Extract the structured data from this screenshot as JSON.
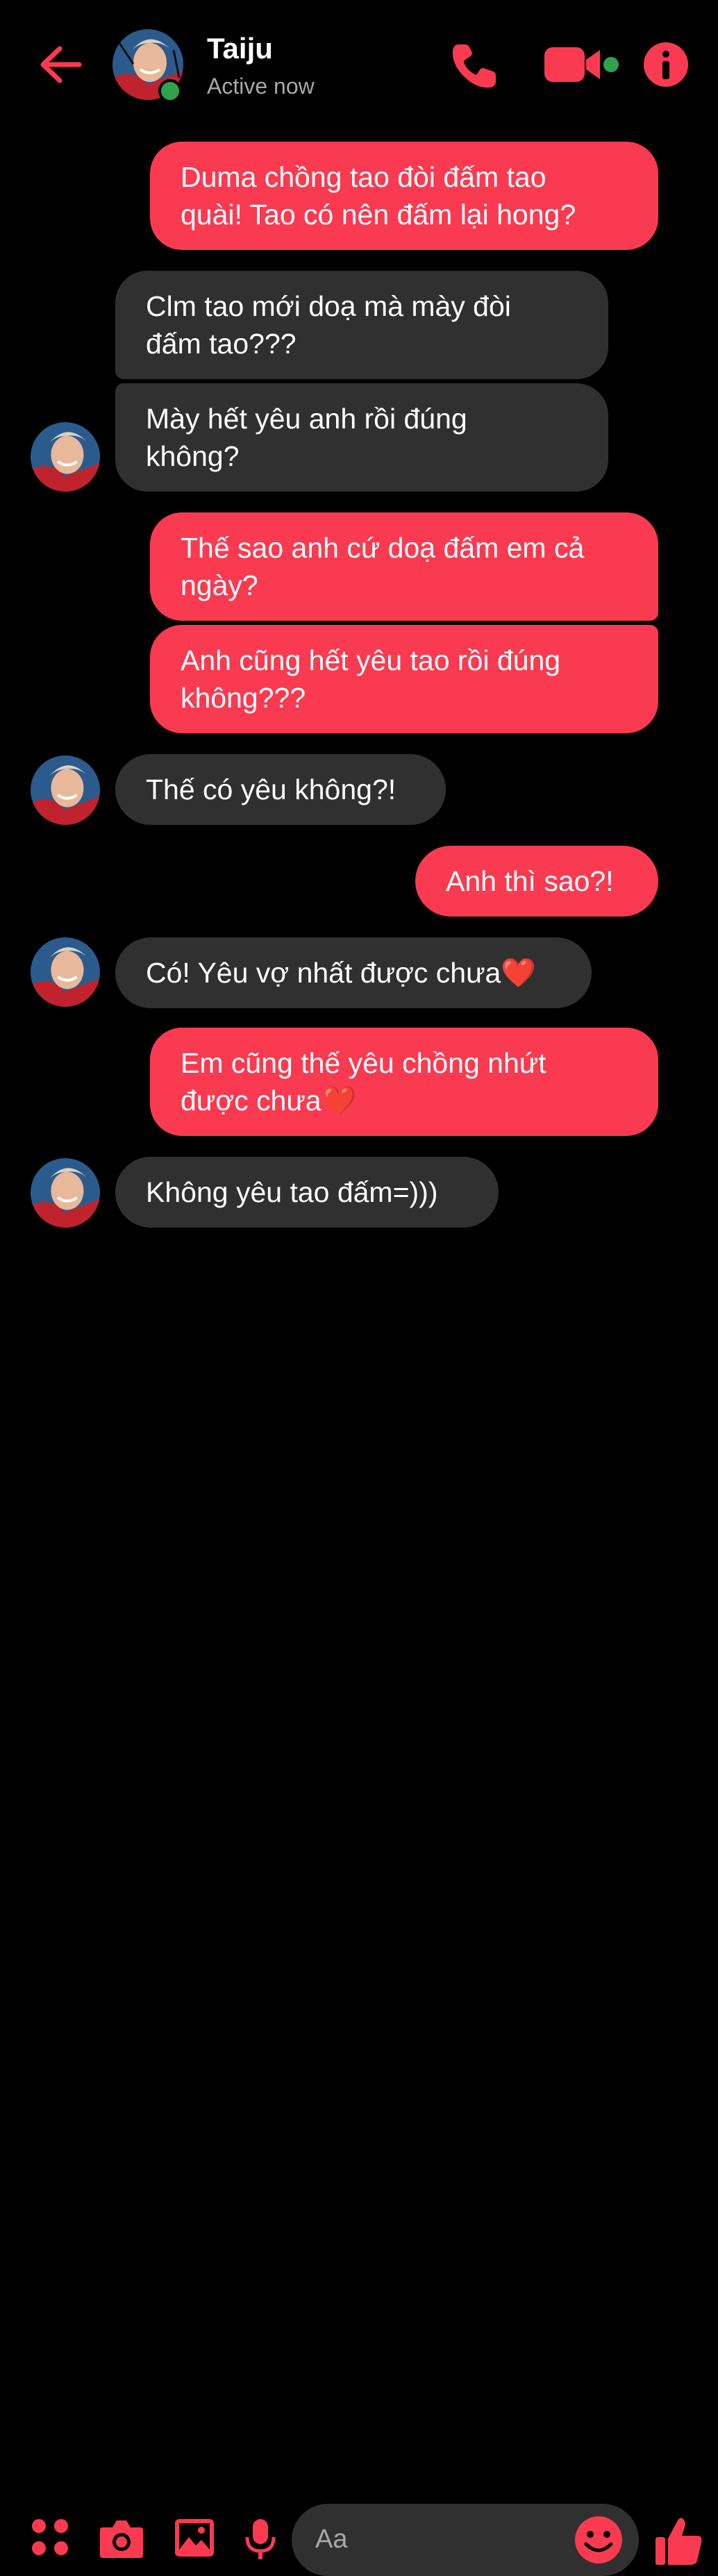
{
  "header": {
    "contact_name": "Taiju",
    "status": "Active now"
  },
  "messages": [
    {
      "side": "out",
      "text": "Duma chồng tao đòi đấm tao\nquài! Tao có nên đấm lại hong?"
    },
    {
      "side": "in",
      "text": "Clm tao mới doạ mà mày đòi\nđấm tao???"
    },
    {
      "side": "in",
      "text": "Mày hết yêu anh rồi đúng\nkhông?"
    },
    {
      "side": "out",
      "text": "Thế sao anh cứ doạ đấm em cả\nngày?"
    },
    {
      "side": "out",
      "text": "Anh cũng hết yêu tao rồi đúng\nkhông???"
    },
    {
      "side": "in",
      "text": "Thế có yêu không?!"
    },
    {
      "side": "out",
      "text": "Anh thì sao?!"
    },
    {
      "side": "in",
      "text": "Có! Yêu vợ nhất được chưa❤️"
    },
    {
      "side": "out",
      "text": "Em cũng thế yêu chồng nhứt\nđược chưa❤️"
    },
    {
      "side": "in",
      "text": "Không yêu tao đấm=)))"
    }
  ],
  "composer": {
    "placeholder": "Aa"
  },
  "colors": {
    "accent": "#fa3a50",
    "incoming_bubble": "#303030",
    "online": "#31a24c",
    "background": "#000000"
  },
  "icons": [
    "back-arrow-icon",
    "phone-icon",
    "video-camera-icon",
    "info-icon",
    "menu-dots-icon",
    "camera-icon",
    "image-icon",
    "microphone-icon",
    "emoji-icon",
    "thumbs-up-icon"
  ]
}
